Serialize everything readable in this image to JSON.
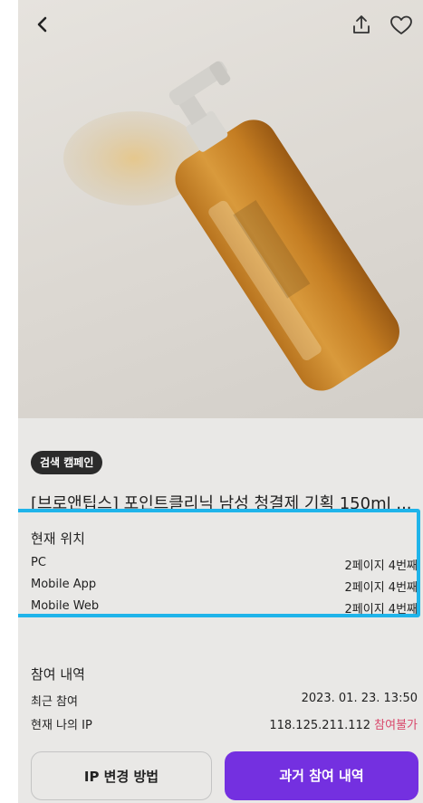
{
  "header": {
    "back_icon": "chevron-left-icon",
    "share_icon": "share-icon",
    "like_icon": "heart-icon"
  },
  "product": {
    "badge": "검색 캠페인",
    "title": "[브로앤팁스] 포인트클리닉 남성 청결제 기획 150ml ..."
  },
  "current_location": {
    "title": "현재 위치",
    "rows": [
      {
        "label": "PC",
        "value": "2페이지 4번째"
      },
      {
        "label": "Mobile App",
        "value": "2페이지 4번째"
      },
      {
        "label": "Mobile Web",
        "value": "2페이지 4번째"
      }
    ]
  },
  "participation": {
    "title": "참여 내역",
    "recent_label": "최근 참여",
    "recent_value": "2023. 01. 23. 13:50",
    "ip_label": "현재 나의 IP",
    "ip_value": "118.125.211.112",
    "ip_status": "참여불가"
  },
  "buttons": {
    "ip_change": "IP 변경 방법",
    "history": "과거 참여 내역"
  },
  "colors": {
    "accent": "#7430e0",
    "highlight": "#1fb4ea",
    "warning": "#d9476b"
  }
}
